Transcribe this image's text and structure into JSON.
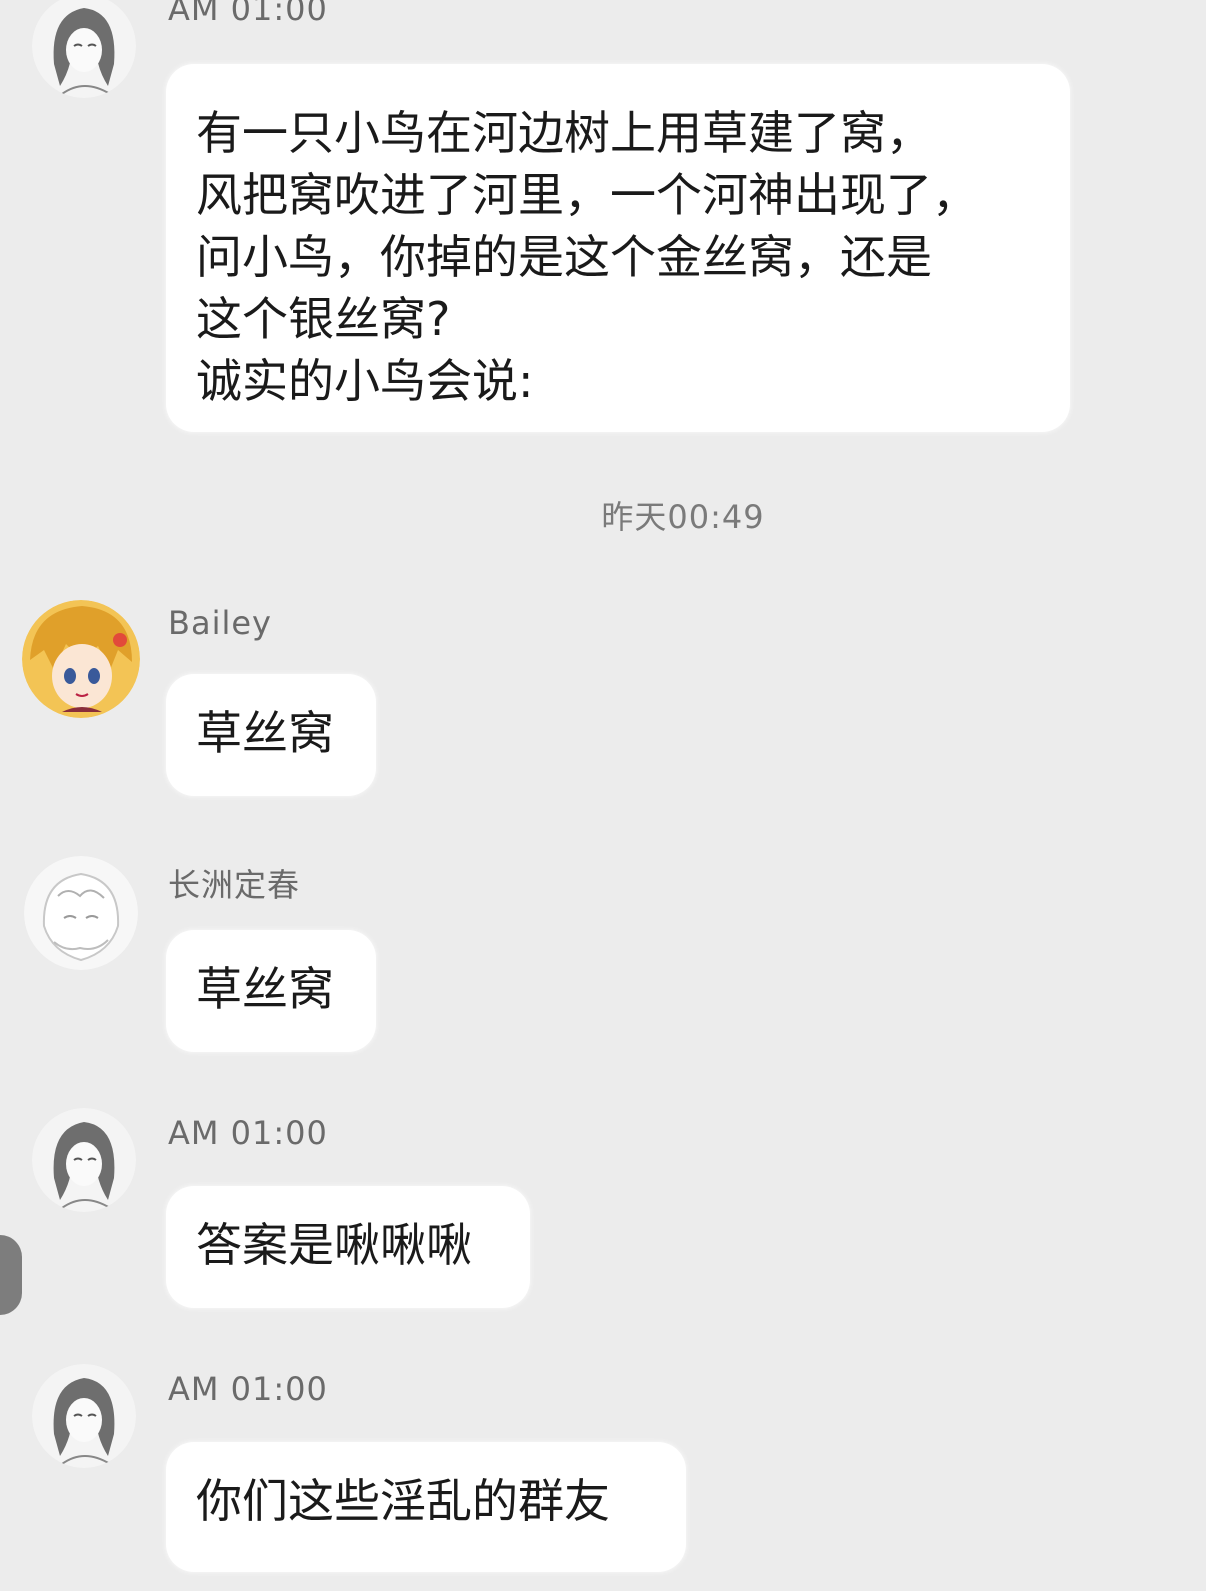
{
  "messages": [
    {
      "sender": "AM 01:00",
      "avatar_icon": "sketch-girl-avatar-icon",
      "lines": [
        "有一只小鸟在河边树上用草建了窝，",
        "风把窝吹进了河里，一个河神出现了，",
        "问小鸟，你掉的是这个金丝窝，还是",
        "这个银丝窝?",
        "诚实的小鸟会说:"
      ]
    },
    {
      "sender": "Bailey",
      "avatar_icon": "anime-blonde-girl-avatar-icon",
      "lines": [
        "草丝窝"
      ]
    },
    {
      "sender": "长洲定春",
      "avatar_icon": "white-sketch-character-avatar-icon",
      "lines": [
        "草丝窝"
      ]
    },
    {
      "sender": "AM 01:00",
      "avatar_icon": "sketch-girl-avatar-icon",
      "lines": [
        "答案是啾啾啾"
      ]
    },
    {
      "sender": "AM 01:00",
      "avatar_icon": "sketch-girl-avatar-icon",
      "lines": [
        "你们这些淫乱的群友"
      ]
    }
  ],
  "time_divider": "昨天00:49",
  "colors": {
    "background": "#ececec",
    "bubble": "#ffffff",
    "text": "#1a1a1a",
    "meta_text": "#6a6a6a"
  }
}
